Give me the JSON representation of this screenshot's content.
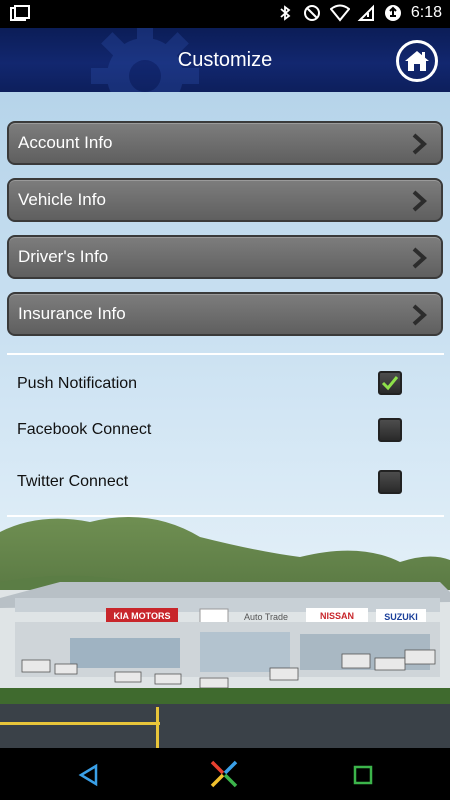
{
  "status_bar": {
    "time": "6:18",
    "icons": [
      "screenshot-icon",
      "bluetooth-icon",
      "do-not-disturb-icon",
      "wifi-icon",
      "no-sim-icon",
      "data-saver-icon"
    ]
  },
  "header": {
    "title": "Customize",
    "home_icon": "home-icon"
  },
  "menu": {
    "items": [
      {
        "label": "Account Info"
      },
      {
        "label": "Vehicle Info"
      },
      {
        "label": "Driver's Info"
      },
      {
        "label": "Insurance Info"
      }
    ]
  },
  "settings": {
    "items": [
      {
        "label": "Push Notification",
        "checked": true
      },
      {
        "label": "Facebook Connect",
        "checked": false
      },
      {
        "label": "Twitter Connect",
        "checked": false
      }
    ]
  },
  "scene": {
    "signs": [
      "KIA MOTORS",
      "Auto Trade",
      "NISSAN",
      "SUZUKI"
    ]
  },
  "colors": {
    "header_bg": "#12276f",
    "button_bg": "#6e6e6e",
    "check_green": "#8ee04a"
  }
}
